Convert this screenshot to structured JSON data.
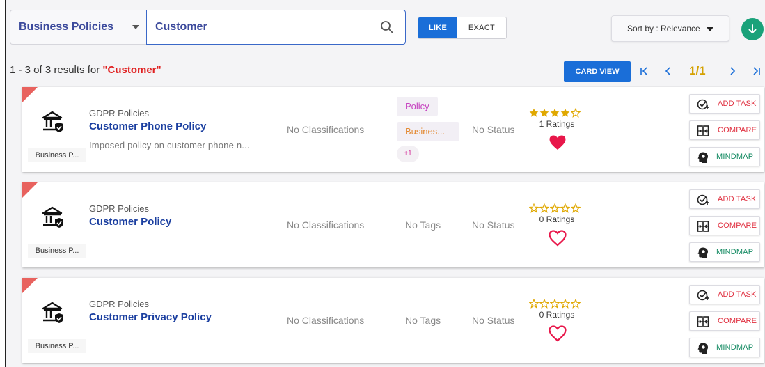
{
  "search": {
    "category": "Business Policies",
    "query": "Customer",
    "modes": [
      "LIKE",
      "EXACT"
    ],
    "active_mode": "LIKE",
    "sort_label": "Sort by : Relevance"
  },
  "results": {
    "count_text": "1 - 3 of 3 results for ",
    "query_text": "\"Customer\"",
    "card_view_label": "CARD VIEW",
    "page": "1/1"
  },
  "actions": {
    "add_task": "ADD TASK",
    "compare": "COMPARE",
    "mindmap": "MINDMAP"
  },
  "colors": {
    "accent_blue": "#1a6ed8",
    "title_blue": "#1b3fa0",
    "heart_red": "#e8174a",
    "star_gold": "#e0a800",
    "corner_red": "#e8625e"
  },
  "cards": [
    {
      "doc_type": "Business P...",
      "category": "GDPR Policies",
      "title": "Customer Phone Policy",
      "description": "Imposed policy on customer phone n...",
      "classification": "No Classifications",
      "tags": [
        "Policy",
        "Busines..."
      ],
      "tags_more": "+1",
      "status": "No Status",
      "rating_stars": 4,
      "ratings_label": "1 Ratings",
      "favorited": true
    },
    {
      "doc_type": "Business P...",
      "category": "GDPR Policies",
      "title": "Customer Policy",
      "description": "",
      "classification": "No Classifications",
      "tags_text": "No Tags",
      "status": "No Status",
      "rating_stars": 0,
      "ratings_label": "0 Ratings",
      "favorited": false
    },
    {
      "doc_type": "Business P...",
      "category": "GDPR Policies",
      "title": "Customer Privacy Policy",
      "description": "",
      "classification": "No Classifications",
      "tags_text": "No Tags",
      "status": "No Status",
      "rating_stars": 0,
      "ratings_label": "0 Ratings",
      "favorited": false
    }
  ]
}
